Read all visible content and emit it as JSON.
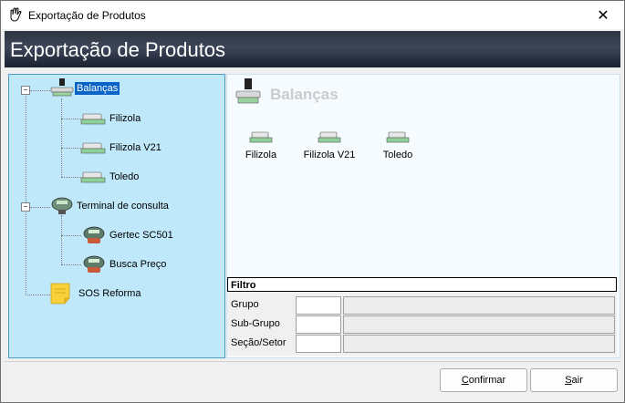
{
  "window": {
    "title": "Exportação de Produtos",
    "close_glyph": "✕"
  },
  "banner": {
    "title": "Exportação de Produtos"
  },
  "tree": {
    "root_scale": {
      "label": "Balanças",
      "expander": "−",
      "icon": "scale-icon"
    },
    "scales": [
      {
        "label": "Filizola",
        "icon": "scale-icon"
      },
      {
        "label": "Filizola V21",
        "icon": "scale-icon"
      },
      {
        "label": "Toledo",
        "icon": "scale-icon"
      }
    ],
    "root_terminal": {
      "label": "Terminal de consulta",
      "expander": "−",
      "icon": "terminal-icon"
    },
    "terminals": [
      {
        "label": "Gertec SC501",
        "icon": "terminal-icon"
      },
      {
        "label": "Busca Preço",
        "icon": "terminal-icon"
      }
    ],
    "root_sos": {
      "label": "SOS Reforma",
      "icon": "note-icon"
    }
  },
  "detail": {
    "title": "Balanças",
    "items": [
      {
        "label": "Filizola"
      },
      {
        "label": "Filizola V21"
      },
      {
        "label": "Toledo"
      }
    ]
  },
  "filter": {
    "header": "Filtro",
    "rows": [
      {
        "label": "Grupo"
      },
      {
        "label": "Sub-Grupo"
      },
      {
        "label": "Seção/Setor"
      }
    ]
  },
  "buttons": {
    "confirm_first": "C",
    "confirm_rest": "onfirmar",
    "exit_first": "S",
    "exit_rest": "air"
  },
  "colors": {
    "tree_bg": "#bfe8fb",
    "selection": "#0a64c8",
    "banner": "#2d3544"
  }
}
